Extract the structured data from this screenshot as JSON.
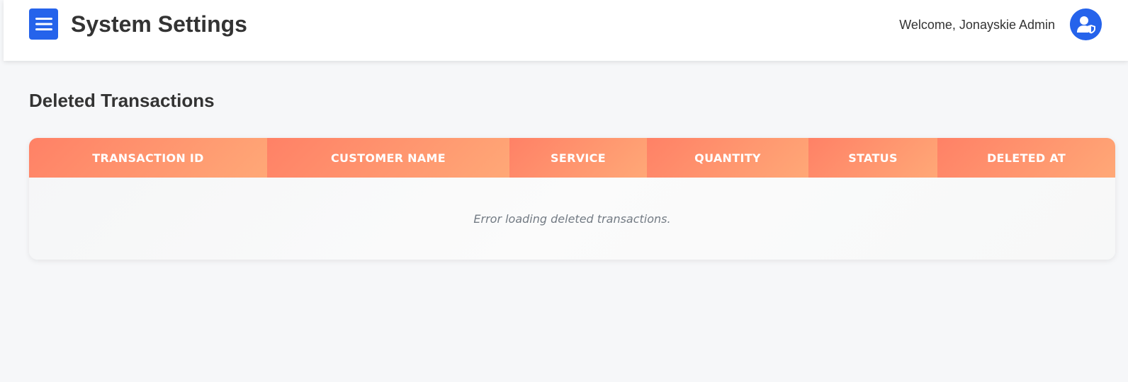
{
  "header": {
    "title": "System Settings",
    "welcome_text": "Welcome, Jonayskie Admin",
    "menu_icon": "hamburger-menu-icon",
    "avatar_icon": "user-shield-icon",
    "accent_color": "#2563eb"
  },
  "section": {
    "title": "Deleted Transactions"
  },
  "table": {
    "columns": [
      "TRANSACTION ID",
      "CUSTOMER NAME",
      "SERVICE",
      "QUANTITY",
      "STATUS",
      "DELETED AT"
    ],
    "empty_message": "Error loading deleted transactions.",
    "header_gradient": [
      "#ff8166",
      "#ffa877"
    ]
  }
}
